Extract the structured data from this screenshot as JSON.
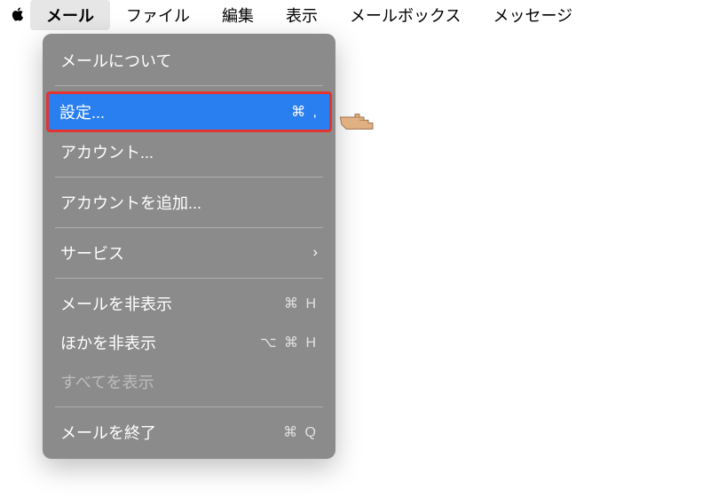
{
  "menubar": {
    "app": "メール",
    "items": [
      "ファイル",
      "編集",
      "表示",
      "メールボックス",
      "メッセージ"
    ]
  },
  "dropdown": {
    "about": "メールについて",
    "settings": {
      "label": "設定...",
      "shortcut": "⌘ ,"
    },
    "accounts": "アカウント...",
    "add_account": "アカウントを追加...",
    "services": "サービス",
    "hide_mail": {
      "label": "メールを非表示",
      "shortcut": "⌘ H"
    },
    "hide_others": {
      "label": "ほかを非表示",
      "shortcut": "⌥ ⌘ H"
    },
    "show_all": "すべてを表示",
    "quit": {
      "label": "メールを終了",
      "shortcut": "⌘ Q"
    }
  }
}
